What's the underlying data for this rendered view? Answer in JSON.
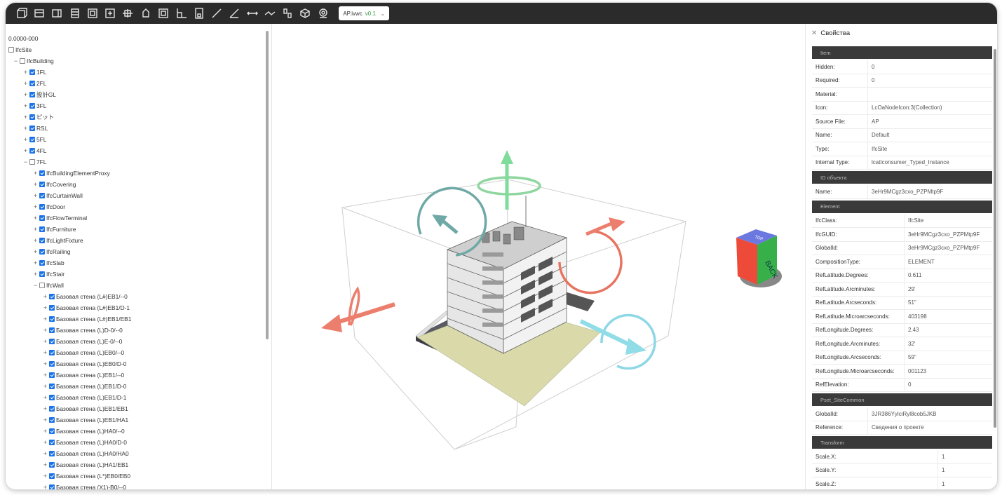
{
  "toolbar": {
    "icons": [
      "cube-front-icon",
      "cube-top-icon",
      "cube-side-icon",
      "cube-left-icon",
      "cube-right-icon",
      "cube-back-icon",
      "section-plane-icon",
      "rotate-cursor-icon",
      "fit-view-icon",
      "axis-icon",
      "clip-box-icon",
      "measure-line-icon",
      "measure-angle-icon",
      "measure-distance-icon",
      "measure-path-icon",
      "explode-icon",
      "reset-view-icon",
      "settings-camera-icon"
    ],
    "model_name": "AP.ivwc",
    "model_version": "v0.1"
  },
  "tree": {
    "root": "0.0000-000",
    "items": [
      {
        "label": "IfcSite",
        "level": 0,
        "expand": "",
        "checked": false
      },
      {
        "label": "IfcBuilding",
        "level": 1,
        "expand": "-",
        "checked": false
      },
      {
        "label": "1FL",
        "level": 2,
        "expand": "+",
        "checked": true
      },
      {
        "label": "2FL",
        "level": 2,
        "expand": "+",
        "checked": true
      },
      {
        "label": "設計GL",
        "level": 2,
        "expand": "+",
        "checked": true
      },
      {
        "label": "3FL",
        "level": 2,
        "expand": "+",
        "checked": true
      },
      {
        "label": "ピット",
        "level": 2,
        "expand": "+",
        "checked": true
      },
      {
        "label": "RSL",
        "level": 2,
        "expand": "+",
        "checked": true
      },
      {
        "label": "5FL",
        "level": 2,
        "expand": "+",
        "checked": true
      },
      {
        "label": "4FL",
        "level": 2,
        "expand": "+",
        "checked": true
      },
      {
        "label": "7FL",
        "level": 2,
        "expand": "-",
        "checked": false
      },
      {
        "label": "IfcBuildingElementProxy",
        "level": 3,
        "expand": "+",
        "checked": true
      },
      {
        "label": "IfcCovering",
        "level": 3,
        "expand": "+",
        "checked": true
      },
      {
        "label": "IfcCurtainWall",
        "level": 3,
        "expand": "+",
        "checked": true
      },
      {
        "label": "IfcDoor",
        "level": 3,
        "expand": "+",
        "checked": true
      },
      {
        "label": "IfcFlowTerminal",
        "level": 3,
        "expand": "+",
        "checked": true
      },
      {
        "label": "IfcFurniture",
        "level": 3,
        "expand": "+",
        "checked": true
      },
      {
        "label": "IfcLightFixture",
        "level": 3,
        "expand": "+",
        "checked": true
      },
      {
        "label": "IfcRailing",
        "level": 3,
        "expand": "+",
        "checked": true
      },
      {
        "label": "IfcSlab",
        "level": 3,
        "expand": "+",
        "checked": true
      },
      {
        "label": "IfcStair",
        "level": 3,
        "expand": "+",
        "checked": true
      },
      {
        "label": "IfcWall",
        "level": 3,
        "expand": "-",
        "checked": false
      },
      {
        "label": "Базовая стена (L#)EB1/--0",
        "level": 4,
        "expand": "+",
        "checked": true
      },
      {
        "label": "Базовая стена (L#)EB1/D-1",
        "level": 4,
        "expand": "+",
        "checked": true
      },
      {
        "label": "Базовая стена (L#)EB1/EB1",
        "level": 4,
        "expand": "+",
        "checked": true
      },
      {
        "label": "Базовая стена (L)D-0/--0",
        "level": 4,
        "expand": "+",
        "checked": true
      },
      {
        "label": "Базовая стена (L)E-0/--0",
        "level": 4,
        "expand": "+",
        "checked": true
      },
      {
        "label": "Базовая стена (L)EB0/--0",
        "level": 4,
        "expand": "+",
        "checked": true
      },
      {
        "label": "Базовая стена (L)EB0/D-0",
        "level": 4,
        "expand": "+",
        "checked": true
      },
      {
        "label": "Базовая стена (L)EB1/--0",
        "level": 4,
        "expand": "+",
        "checked": true
      },
      {
        "label": "Базовая стена (L)EB1/D-0",
        "level": 4,
        "expand": "+",
        "checked": true
      },
      {
        "label": "Базовая стена (L)EB1/D-1",
        "level": 4,
        "expand": "+",
        "checked": true
      },
      {
        "label": "Базовая стена (L)EB1/EB1",
        "level": 4,
        "expand": "+",
        "checked": true
      },
      {
        "label": "Базовая стена (L)EB1/HA1",
        "level": 4,
        "expand": "+",
        "checked": true
      },
      {
        "label": "Базовая стена (L)HA0/--0",
        "level": 4,
        "expand": "+",
        "checked": true
      },
      {
        "label": "Базовая стена (L)HA0/D-0",
        "level": 4,
        "expand": "+",
        "checked": true
      },
      {
        "label": "Базовая стена (L)HA0/HA0",
        "level": 4,
        "expand": "+",
        "checked": true
      },
      {
        "label": "Базовая стена (L)HA1/EB1",
        "level": 4,
        "expand": "+",
        "checked": true
      },
      {
        "label": "Базовая стена (L*)EB0/EB0",
        "level": 4,
        "expand": "+",
        "checked": true
      },
      {
        "label": "Базовая стена (X1)-B0/--0",
        "level": 4,
        "expand": "+",
        "checked": true
      }
    ]
  },
  "viewcube": {
    "face_label": "BACK",
    "top_label": "TOP"
  },
  "colors": {
    "rotate_red": "#e8735f",
    "rotate_teal": "#6fa9a6",
    "rotate_green": "#8fd6a0",
    "rotate_cyan": "#8ed7e6",
    "arrow_red": "#ec7e6d",
    "arrow_green": "#7fdc9a",
    "arrow_cyan": "#90dde8",
    "ground": "#d8d8a8"
  },
  "props": {
    "title": "Свойства",
    "sections": [
      {
        "title": "Item",
        "rows": [
          [
            "Hidden:",
            "0"
          ],
          [
            "Required:",
            "0"
          ],
          [
            "Material:",
            ""
          ],
          [
            "Icon:",
            "LcOaNodeIcon:3(Collection)"
          ],
          [
            "Source File:",
            "AP"
          ],
          [
            "Name:",
            "Default"
          ],
          [
            "Type:",
            "IfcSite"
          ],
          [
            "Internal Type:",
            "lcatIconsumer_Typed_Instance"
          ]
        ]
      },
      {
        "title": "ID объекта",
        "rows": [
          [
            "Name:",
            "3eHr9MCgz3cxo_PZPMtp9F"
          ]
        ]
      },
      {
        "title": "Element",
        "rows": [
          [
            "IfcClass:",
            "IfcSite"
          ],
          [
            "IfcGUID:",
            "3eHr9MCgz3cxo_PZPMtp9F"
          ],
          [
            "GlobalId:",
            "3eHr9MCgz3cxo_PZPMtp9F"
          ],
          [
            "CompositionType:",
            "ELEMENT"
          ],
          [
            "RefLatitude.Degrees:",
            "0.611"
          ],
          [
            "RefLatitude.Arcminutes:",
            "29'"
          ],
          [
            "RefLatitude.Arcseconds:",
            "51\""
          ],
          [
            "RefLatitude.Microarcseconds:",
            "403198"
          ],
          [
            "RefLongitude.Degrees:",
            "2.43"
          ],
          [
            "RefLongitude.Arcminutes:",
            "32'"
          ],
          [
            "RefLongitude.Arcseconds:",
            "59\""
          ],
          [
            "RefLongitude.Microarcseconds:",
            "001123"
          ],
          [
            "RefElevation:",
            "0"
          ]
        ]
      },
      {
        "title": "Pset_SiteCommon",
        "rows": [
          [
            "GlobalId:",
            "3JR386YylciRyl8cob5JKB"
          ],
          [
            "Reference:",
            "Сведения о проекте"
          ]
        ]
      },
      {
        "title": "Transform",
        "rows": [
          [
            "Scale.X:",
            "1"
          ],
          [
            "Scale.Y:",
            "1"
          ],
          [
            "Scale.Z:",
            "1"
          ]
        ]
      }
    ]
  }
}
